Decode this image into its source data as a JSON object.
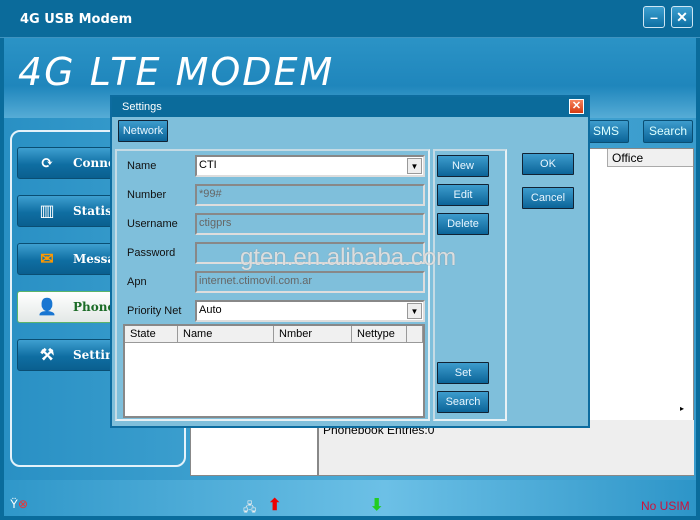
{
  "window": {
    "title": "4G USB Modem",
    "logo": "4G LTE MODEM",
    "minimize": "–",
    "close": "✕"
  },
  "nav": [
    {
      "label": "Connect",
      "icon": "connect-icon",
      "glyph": "⟳"
    },
    {
      "label": "Statistics",
      "icon": "statistics-icon",
      "glyph": "▥"
    },
    {
      "label": "Message",
      "icon": "message-icon",
      "glyph": "✉"
    },
    {
      "label": "Phonebook",
      "icon": "phonebook-icon",
      "glyph": "👤",
      "active": true
    },
    {
      "label": "Settings",
      "icon": "tools-icon",
      "glyph": "⚒"
    }
  ],
  "toolbar": {
    "sms": "SMS",
    "search": "Search"
  },
  "list": {
    "office_header": "Office",
    "status": "Phonebook Entries:0"
  },
  "status": {
    "sim": "No USIM"
  },
  "dialog": {
    "title": "Settings",
    "tab": "Network",
    "fields": {
      "name_label": "Name",
      "name_value": "CTI",
      "number_label": "Number",
      "number_value": "*99#",
      "username_label": "Username",
      "username_value": "ctigprs",
      "password_label": "Password",
      "password_value": "",
      "apn_label": "Apn",
      "apn_value": "internet.ctimovil.com.ar",
      "priority_label": "Priority Net",
      "priority_value": "Auto"
    },
    "columns": [
      "State",
      "Name",
      "Nmber",
      "Nettype"
    ],
    "buttons": {
      "new": "New",
      "edit": "Edit",
      "delete": "Delete",
      "set": "Set",
      "search": "Search",
      "ok": "OK",
      "cancel": "Cancel"
    }
  },
  "watermark": "gten.en.alibaba.com"
}
